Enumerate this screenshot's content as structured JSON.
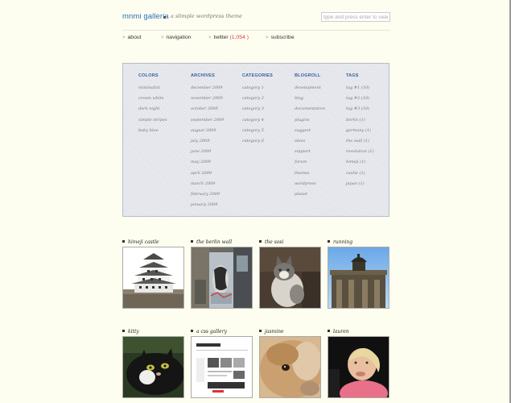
{
  "header": {
    "site_title": "mnmi galleria",
    "tagline": "a slimple wordpress theme",
    "search_placeholder": "type and press enter to search"
  },
  "nav": {
    "about": "about",
    "navigation": "navigation",
    "twitter": "twitter",
    "twitter_count": "(1,054 )",
    "subscribe": "subscribe"
  },
  "panel": {
    "colors": {
      "title": "COLORS",
      "items": [
        "minimalist",
        "cream white",
        "dark night",
        "simple stripes",
        "baby blue"
      ]
    },
    "archives": {
      "title": "ARCHIVES",
      "items": [
        "december 2009",
        "november 2009",
        "october 2009",
        "september 2009",
        "august 2009",
        "july 2009",
        "june 2009",
        "may 2009",
        "april 2009",
        "march 2009",
        "february 2009",
        "january 2009"
      ]
    },
    "categories": {
      "title": "CATEGORIES",
      "items": [
        "category 1",
        "category 2",
        "category 3",
        "category 4",
        "category 5",
        "category 6"
      ]
    },
    "blogroll": {
      "title": "BLOGROLL",
      "items": [
        "development",
        "blog",
        "documentation",
        "plugins",
        "suggest",
        "ideas",
        "support",
        "forum",
        "themes",
        "wordpress",
        "planet"
      ]
    },
    "tags": {
      "title": "TAGS",
      "items": [
        "tag #1 (10)",
        "tag #2 (10)",
        "tag #3 (10)",
        "berlin (1)",
        "germany (1)",
        "the wall (1)",
        "revolution (1)",
        "himeji (1)",
        "castle (1)",
        "japan (1)"
      ]
    }
  },
  "gallery": [
    {
      "title": "himeji castle"
    },
    {
      "title": "the berlin wall"
    },
    {
      "title": "the sosi"
    },
    {
      "title": "running"
    },
    {
      "title": "kitty"
    },
    {
      "title": "a css gallery"
    },
    {
      "title": "jasmine"
    },
    {
      "title": "lauren"
    }
  ]
}
